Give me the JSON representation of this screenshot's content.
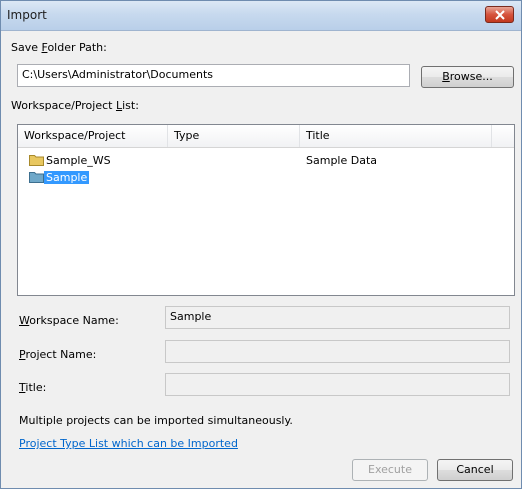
{
  "window": {
    "title": "Import"
  },
  "save_folder": {
    "label_pre": "Save ",
    "label_key": "F",
    "label_post": "older Path:",
    "value": "C:\\Users\\Administrator\\Documents",
    "browse_pre": "",
    "browse_key": "B",
    "browse_post": "rowse..."
  },
  "list": {
    "label_pre": "Workspace/Project ",
    "label_key": "L",
    "label_post": "ist:",
    "columns": [
      "Workspace/Project",
      "Type",
      "Title"
    ],
    "rows": [
      {
        "name": "Sample_WS",
        "type": "",
        "title": "Sample Data",
        "icon": "folder-icon"
      },
      {
        "name": "Sample",
        "type": "",
        "title": "",
        "icon": "folder-icon"
      }
    ]
  },
  "workspace_name": {
    "label_key": "W",
    "label_post": "orkspace Name:",
    "value": "Sample"
  },
  "project_name": {
    "label_key": "P",
    "label_post": "roject Name:",
    "value": ""
  },
  "title_field": {
    "label_key": "T",
    "label_post": "itle:",
    "value": ""
  },
  "info_text": "Multiple projects can be imported simultaneously.",
  "link_text": "Project Type List which can be Imported",
  "buttons": {
    "execute": "Execute",
    "cancel": "Cancel"
  },
  "colors": {
    "selection": "#3399ff",
    "link": "#0066cc",
    "folder": "#e8c760"
  }
}
